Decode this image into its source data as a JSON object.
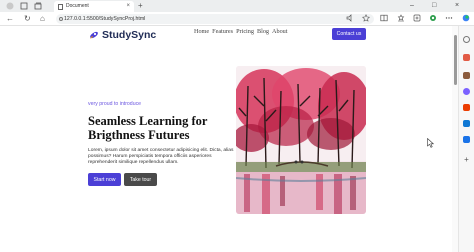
{
  "browser": {
    "tab_title": "Document",
    "tab_close": "×",
    "new_tab": "+",
    "url": "127.0.0.1:5500/StudySyncProj.html",
    "window_controls": [
      "–",
      "□",
      "×"
    ],
    "nav": {
      "back": "←",
      "refresh": "↻",
      "home": "⌂"
    }
  },
  "site": {
    "brand": "StudySync",
    "menu": [
      "Home",
      "Features",
      "Pricing",
      "Blog",
      "About"
    ],
    "contact_label": "Contact us"
  },
  "hero": {
    "eyebrow": "very proud to introduce",
    "headline": "Seamless Learning for Brigthness Futures",
    "body": "Lorem, ipsum dolor sit amet consectetur adipisicing elit. Dicta, alias possimus? Harum perspiciatis tempora officiis asperiores reprehenderit similique repellendus ullam.",
    "primary_cta": "Start now",
    "secondary_cta": "Take tour"
  },
  "colors": {
    "accent": "#4b3fd6",
    "brand_text": "#1f2b55",
    "eyebrow": "#6b56e0",
    "secondary_button": "#4a4a4a"
  },
  "icons": {
    "sidebar": [
      "search-icon",
      "tag-icon",
      "briefcase-icon",
      "person-icon",
      "office-icon",
      "outlook-icon",
      "send-icon",
      "add-icon"
    ],
    "toolbar": [
      "read-aloud-icon",
      "favorite-icon",
      "split-screen-icon",
      "favorites-bar-icon",
      "collections-icon",
      "extensions-icon",
      "profile-icon",
      "more-icon"
    ]
  }
}
